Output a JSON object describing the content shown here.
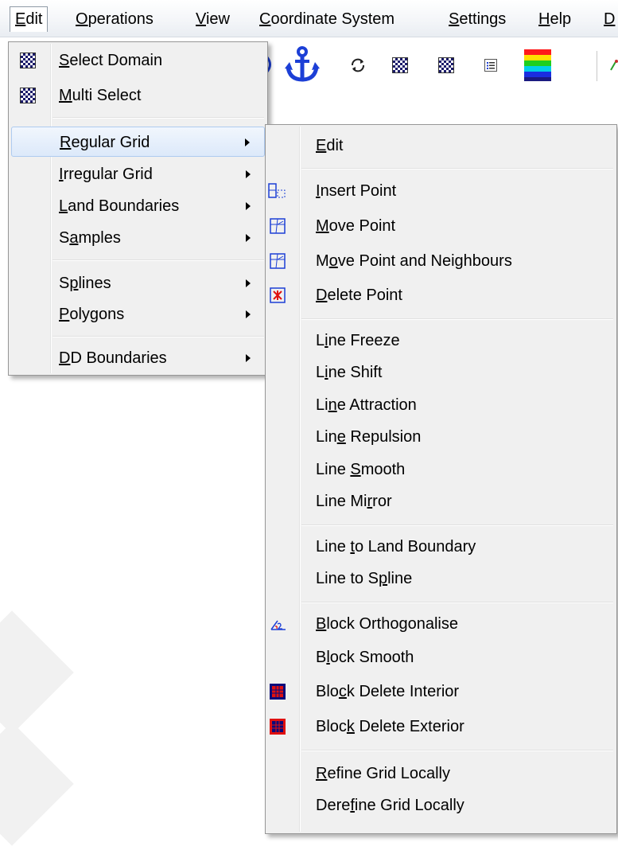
{
  "menubar": {
    "items": [
      {
        "label": "Edit",
        "u": "E",
        "rest": "dit"
      },
      {
        "label": "Operations",
        "u": "O",
        "rest": "perations"
      },
      {
        "label": "View",
        "u": "V",
        "rest": "iew"
      },
      {
        "label": "Coordinate System",
        "u": "C",
        "rest": "oordinate System"
      },
      {
        "label": "Settings",
        "u": "S",
        "rest": "ettings"
      },
      {
        "label": "Help",
        "u": "H",
        "rest": "elp"
      },
      {
        "label": "D",
        "u": "D",
        "rest": ""
      }
    ]
  },
  "toolbar": {
    "icons": [
      "anchor-icon",
      "refresh-icon",
      "select-domain-icon",
      "multi-select-icon",
      "list-icon",
      "color-scale-icon"
    ]
  },
  "edit_menu": {
    "items": [
      {
        "pre": "",
        "u": "S",
        "post": "elect Domain"
      },
      {
        "pre": "",
        "u": "M",
        "post": "ulti Select"
      },
      {
        "pre": "",
        "u": "R",
        "post": "egular Grid"
      },
      {
        "pre": "",
        "u": "I",
        "post": "rregular Grid"
      },
      {
        "pre": "",
        "u": "L",
        "post": "and Boundaries"
      },
      {
        "pre": "S",
        "u": "a",
        "post": "mples"
      },
      {
        "pre": "S",
        "u": "p",
        "post": "lines"
      },
      {
        "pre": "",
        "u": "P",
        "post": "olygons"
      },
      {
        "pre": "",
        "u": "D",
        "post": "D Boundaries"
      }
    ]
  },
  "regular_grid_menu": {
    "items": [
      {
        "pre": "",
        "u": "E",
        "post": "dit"
      },
      {
        "pre": "",
        "u": "I",
        "post": "nsert Point"
      },
      {
        "pre": "",
        "u": "M",
        "post": "ove Point"
      },
      {
        "pre": "M",
        "u": "o",
        "post": "ve Point and Neighbours"
      },
      {
        "pre": "",
        "u": "D",
        "post": "elete Point"
      },
      {
        "pre": "L",
        "u": "i",
        "post": "ne Freeze"
      },
      {
        "pre": "L",
        "u": "i",
        "post": "ne Shift"
      },
      {
        "pre": "Li",
        "u": "n",
        "post": "e Attraction"
      },
      {
        "pre": "Lin",
        "u": "e",
        "post": " Repulsion"
      },
      {
        "pre": "Line ",
        "u": "S",
        "post": "mooth"
      },
      {
        "pre": "Line Mi",
        "u": "r",
        "post": "ror"
      },
      {
        "pre": "Line ",
        "u": "t",
        "post": "o Land Boundary"
      },
      {
        "pre": "Line to S",
        "u": "p",
        "post": "line"
      },
      {
        "pre": "",
        "u": "B",
        "post": "lock Orthogonalise"
      },
      {
        "pre": "B",
        "u": "l",
        "post": "ock Smooth"
      },
      {
        "pre": "Blo",
        "u": "c",
        "post": "k Delete Interior"
      },
      {
        "pre": "Bloc",
        "u": "k",
        "post": " Delete Exterior"
      },
      {
        "pre": "",
        "u": "R",
        "post": "efine Grid Locally"
      },
      {
        "pre": "Dere",
        "u": "f",
        "post": "ine Grid Locally"
      }
    ]
  },
  "colors": {
    "menu_bg": "#f0f0f0",
    "highlight": "#dce9fa",
    "highlight_border": "#aecbf0",
    "anchor_blue": "#1c3fd6"
  }
}
